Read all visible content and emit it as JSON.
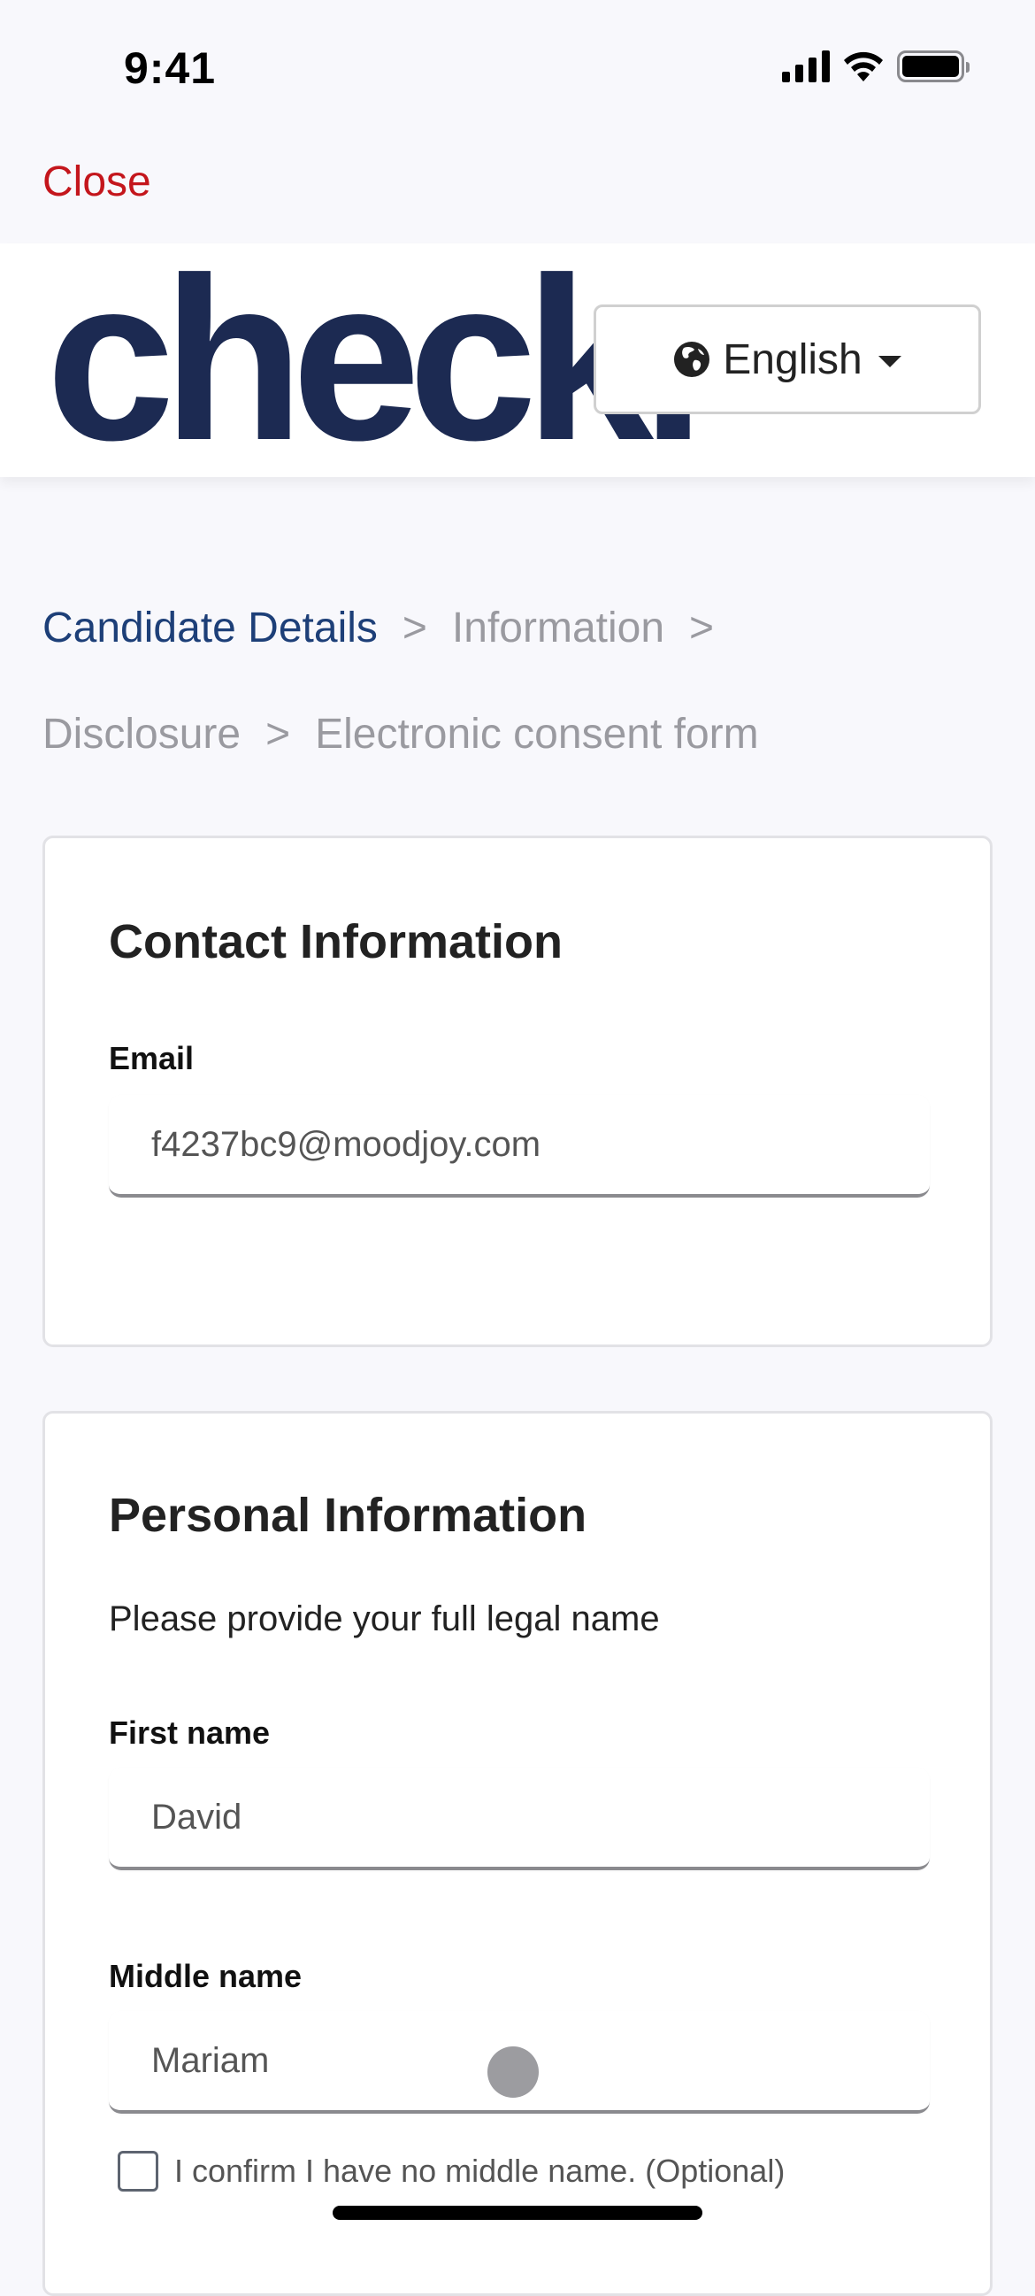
{
  "status_bar": {
    "time": "9:41",
    "icons": [
      "cellular-signal-icon",
      "wifi-icon",
      "battery-icon"
    ]
  },
  "nav": {
    "close_label": "Close"
  },
  "header": {
    "logo_text": "check.",
    "language_button": {
      "icon": "globe-icon",
      "label": "English",
      "caret_icon": "caret-down-icon"
    }
  },
  "breadcrumb": {
    "items": [
      {
        "label": "Candidate Details",
        "active": true
      },
      {
        "label": "Information",
        "active": false
      },
      {
        "label": "Disclosure",
        "active": false
      },
      {
        "label": "Electronic consent form",
        "active": false
      }
    ],
    "separator": ">"
  },
  "contact_card": {
    "title": "Contact Information",
    "email": {
      "label": "Email",
      "value": "f4237bc9@moodjoy.com"
    }
  },
  "personal_card": {
    "title": "Personal Information",
    "subtitle": "Please provide your full legal name",
    "first_name": {
      "label": "First name",
      "value": "David"
    },
    "middle_name": {
      "label": "Middle name",
      "value": "Mariam"
    },
    "no_middle_name_checkbox": {
      "label": "I confirm I have no middle name. (Optional)",
      "checked": false
    }
  },
  "colors": {
    "close": "#c4161c",
    "logo": "#1c2a52",
    "breadcrumb_active": "#1d3f78",
    "breadcrumb_inactive": "#9a9aa0",
    "background": "#f8f8fc"
  }
}
